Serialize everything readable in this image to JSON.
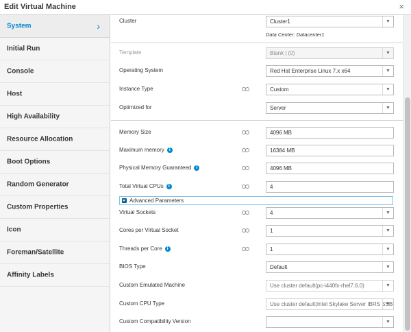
{
  "dialog": {
    "title": "Edit Virtual Machine",
    "close_glyph": "×"
  },
  "sidebar": {
    "items": [
      {
        "label": "System",
        "active": true
      },
      {
        "label": "Initial Run"
      },
      {
        "label": "Console"
      },
      {
        "label": "Host"
      },
      {
        "label": "High Availability"
      },
      {
        "label": "Resource Allocation"
      },
      {
        "label": "Boot Options"
      },
      {
        "label": "Random Generator"
      },
      {
        "label": "Custom Properties"
      },
      {
        "label": "Icon"
      },
      {
        "label": "Foreman/Satellite"
      },
      {
        "label": "Affinity Labels"
      }
    ],
    "active_chevron": "›"
  },
  "form": {
    "cluster": {
      "label": "Cluster",
      "value": "Cluster1",
      "note": "Data Center: Datacenter1"
    },
    "template": {
      "label": "Template",
      "value": "Blank |  (0)"
    },
    "os": {
      "label": "Operating System",
      "value": "Red Hat Enterprise Linux 7.x x64"
    },
    "instance_type": {
      "label": "Instance Type",
      "value": "Custom"
    },
    "optimized_for": {
      "label": "Optimized for",
      "value": "Server"
    },
    "memory_size": {
      "label": "Memory Size",
      "value": "4096 MB"
    },
    "max_memory": {
      "label": "Maximum memory",
      "value": "16384 MB"
    },
    "phys_mem": {
      "label": "Physical Memory Guaranteed",
      "value": "4096 MB"
    },
    "total_vcpus": {
      "label": "Total Virtual CPUs",
      "value": "4"
    },
    "advanced": {
      "label": "Advanced Parameters"
    },
    "virtual_sockets": {
      "label": "Virtual Sockets",
      "value": "4"
    },
    "cores_per_socket": {
      "label": "Cores per Virtual Socket",
      "value": "1"
    },
    "threads_per_core": {
      "label": "Threads per Core",
      "value": "1"
    },
    "bios_type": {
      "label": "BIOS Type",
      "value": "Default"
    },
    "emulated_machine": {
      "label": "Custom Emulated Machine",
      "value": "Use cluster default(pc-i440fx-rhel7.6.0)"
    },
    "cpu_type": {
      "label": "Custom CPU Type",
      "value": "Use cluster default(Intel Skylake Server IBRS SSBD)"
    },
    "compat_version": {
      "label": "Custom Compatibility Version",
      "value": ""
    }
  },
  "icons": {
    "info": "info-icon",
    "link": "chain-link-icon",
    "caret": "caret-down-icon"
  },
  "colors": {
    "accent": "#0088ce",
    "info": "#0088ce"
  }
}
